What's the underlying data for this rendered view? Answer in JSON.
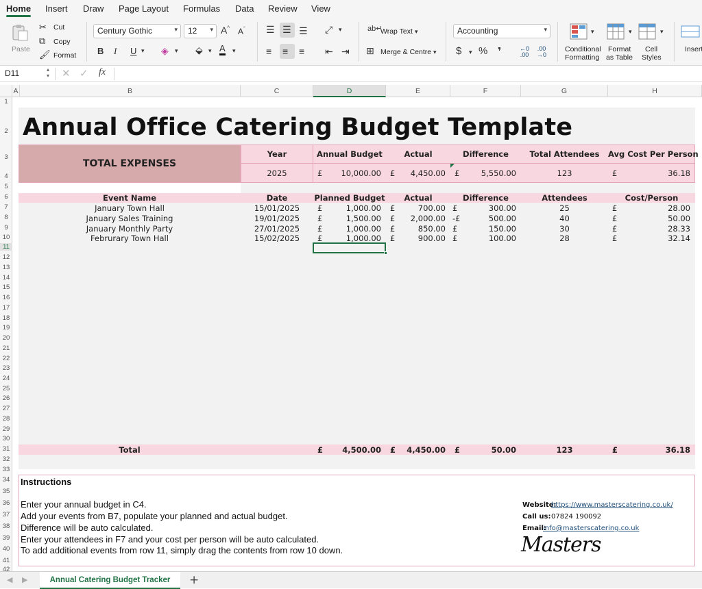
{
  "menu": {
    "items": [
      "Home",
      "Insert",
      "Draw",
      "Page Layout",
      "Formulas",
      "Data",
      "Review",
      "View"
    ]
  },
  "ribbon": {
    "paste": "Paste",
    "cut": "Cut",
    "copy": "Copy",
    "format": "Format",
    "font_name": "Century Gothic",
    "font_size": "12",
    "wrap_text": "Wrap Text",
    "merge_centre": "Merge & Centre",
    "number_format": "Accounting",
    "conditional": [
      "Conditional",
      "Formatting"
    ],
    "format_table": [
      "Format",
      "as Table"
    ],
    "cell_styles": [
      "Cell",
      "Styles"
    ],
    "insert": "Insert",
    "bold": "B",
    "italic": "I",
    "underline": "U",
    "currency": "$",
    "percent": "%",
    "comma": "❜"
  },
  "formula_bar": {
    "name_box": "D11",
    "fx": "fx",
    "formula": ""
  },
  "columns": [
    "A",
    "B",
    "C",
    "D",
    "E",
    "F",
    "G",
    "H"
  ],
  "rows": [
    "1",
    "2",
    "3",
    "4",
    "5",
    "6",
    "7",
    "8",
    "9",
    "10",
    "11",
    "12",
    "13",
    "14",
    "15",
    "16",
    "17",
    "18",
    "19",
    "20",
    "21",
    "22",
    "23",
    "24",
    "25",
    "26",
    "27",
    "28",
    "29",
    "30",
    "31",
    "32",
    "33",
    "34",
    "35",
    "36",
    "37",
    "38",
    "39",
    "40",
    "41",
    "42"
  ],
  "sheet": {
    "title": "Annual Office Catering Budget Template",
    "total_expenses": "TOTAL EXPENSES",
    "summary_headers": [
      "Year",
      "Annual Budget",
      "Actual",
      "Difference",
      "Total Attendees",
      "Avg Cost Per Person"
    ],
    "summary_values": {
      "year": "2025",
      "annual_budget": "10,000.00",
      "actual": "4,450.00",
      "difference": "5,550.00",
      "attendees": "123",
      "avg_cost": "36.18"
    },
    "currency": "£",
    "event_headers": [
      "Event Name",
      "Date",
      "Planned Budget",
      "Actual",
      "Difference",
      "Attendees",
      "Cost/Person"
    ],
    "events": [
      {
        "name": "January Town Hall",
        "date": "15/01/2025",
        "planned": "1,000.00",
        "actual": "700.00",
        "diff": "300.00",
        "diff_prefix": "£",
        "attendees": "25",
        "cpp": "28.00"
      },
      {
        "name": "January Sales Training",
        "date": "19/01/2025",
        "planned": "1,500.00",
        "actual": "2,000.00",
        "diff": "500.00",
        "diff_prefix": "-£",
        "attendees": "40",
        "cpp": "50.00"
      },
      {
        "name": "January Monthly Party",
        "date": "27/01/2025",
        "planned": "1,000.00",
        "actual": "850.00",
        "diff": "150.00",
        "diff_prefix": "£",
        "attendees": "30",
        "cpp": "28.33"
      },
      {
        "name": "Februrary Town Hall",
        "date": "15/02/2025",
        "planned": "1,000.00",
        "actual": "900.00",
        "diff": "100.00",
        "diff_prefix": "£",
        "attendees": "28",
        "cpp": "32.14"
      }
    ],
    "total": {
      "label": "Total",
      "planned": "4,500.00",
      "actual": "4,450.00",
      "diff": "50.00",
      "attendees": "123",
      "cpp": "36.18"
    },
    "instructions": {
      "heading": "Instructions",
      "lines": [
        "Enter your annual budget in C4.",
        "Add your events from B7, populate your planned and actual budget.",
        "Difference will be auto calculated.",
        "Enter your attendees in F7 and your cost per person will be auto calculated.",
        "To add additional events from row 11, simply drag the contents from row 10 down."
      ]
    },
    "contact": {
      "website_label": "Website:",
      "website": "https://www.masterscatering.co.uk/",
      "call_label": "Call us:",
      "call": "07824 190092",
      "email_label": "Email:",
      "email": "info@masterscatering.co.uk",
      "logo": "Masters"
    }
  },
  "tabs": {
    "sheet_name": "Annual Catering Budget Tracker",
    "add": "+"
  },
  "colors": {
    "accent": "#217346",
    "pink": "#f8d7e0",
    "rose": "#d6a9ab"
  }
}
